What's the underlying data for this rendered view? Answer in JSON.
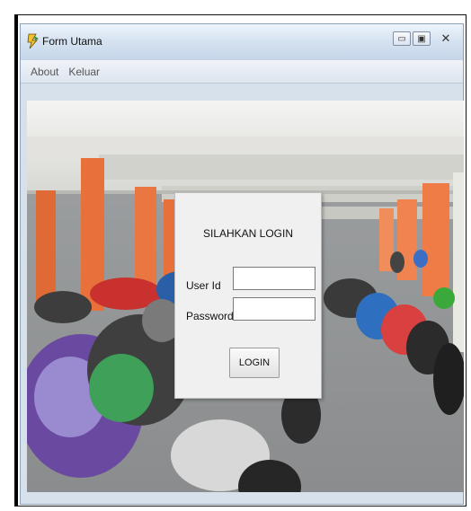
{
  "window": {
    "title": "Form Utama",
    "minimize_glyph": "▭",
    "maximize_glyph": "▣",
    "close_glyph": "✕",
    "app_icon": "app-logo-icon"
  },
  "menu": {
    "items": [
      "About",
      "Keluar"
    ]
  },
  "background_image": "motorcycle-parking-garage",
  "login": {
    "title": "SILAHKAN LOGIN",
    "user_label": "User Id",
    "password_label": "Password",
    "user_value": "",
    "password_value": "",
    "button_label": "LOGIN"
  },
  "colors": {
    "titlebar": "#d6e3f1",
    "panel": "#f0f0f0",
    "pillar_orange": "#e8703a"
  }
}
